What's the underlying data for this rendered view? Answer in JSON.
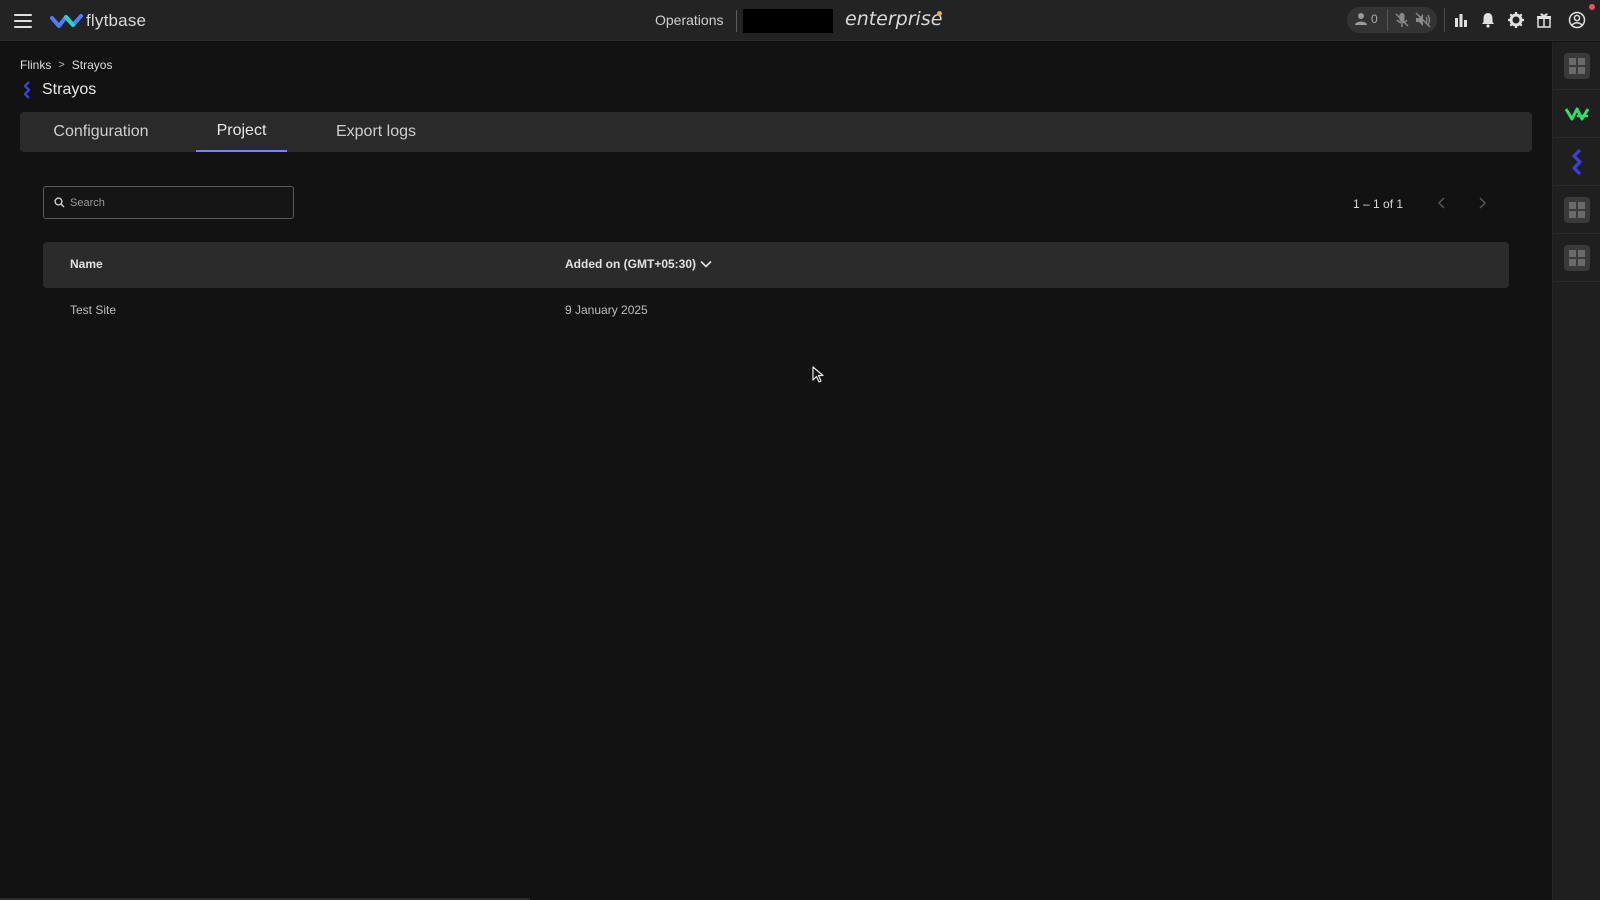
{
  "app": {
    "logo_text": "flytbase",
    "section": "Operations",
    "edition": "enterprise"
  },
  "header": {
    "operator_count": "0",
    "colors": {
      "accent": "#6b8cff",
      "logo_blue": "#4d7cff",
      "logo_teal": "#2bd1c4",
      "notification": "#ff4a5a"
    },
    "icons": [
      "menu-icon",
      "user-icon",
      "mic-off-icon",
      "speaker-off-icon",
      "bar-chart-icon",
      "bell-icon",
      "gear-icon",
      "gift-icon",
      "account-icon"
    ]
  },
  "breadcrumb": {
    "root": "Flinks",
    "current": "Strayos"
  },
  "page": {
    "title": "Strayos"
  },
  "tabs": [
    {
      "label": "Configuration",
      "active": false
    },
    {
      "label": "Project",
      "active": true
    },
    {
      "label": "Export logs",
      "active": false
    }
  ],
  "search": {
    "placeholder": "Search",
    "value": ""
  },
  "pagination": {
    "label": "1 – 1 of 1"
  },
  "table": {
    "columns": [
      "Name",
      "Added on (GMT+05:30)"
    ],
    "rows": [
      {
        "name": "Test Site",
        "added_on": "9 January 2025"
      }
    ]
  },
  "rail": {
    "items": [
      "widget-tile",
      "vantage-logo",
      "strayos-logo",
      "widget-tile",
      "widget-tile"
    ]
  }
}
